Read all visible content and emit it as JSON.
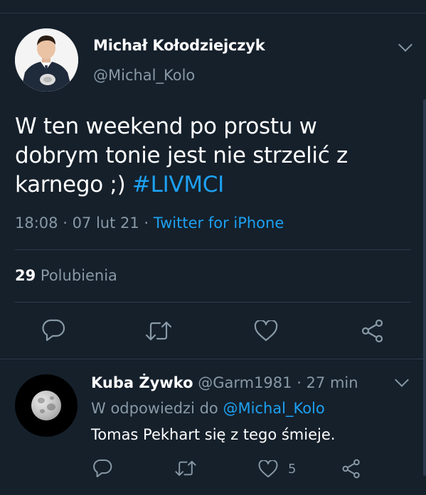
{
  "tweet": {
    "author_name": "Michał Kołodziejczyk",
    "author_handle": "@Michal_Kolo",
    "text": "W ten weekend po prostu w dobrym tonie jest nie strzelić z karnego ;) ",
    "hashtag": "#LIVMCI",
    "time": "18:08",
    "date": "07 lut 21",
    "source": "Twitter for iPhone",
    "likes_count": "29",
    "likes_label": "Polubienia"
  },
  "reply": {
    "author_name": "Kuba Żywko",
    "author_handle": "@Garm1981",
    "time_ago": "27 min",
    "reply_to_prefix": "W odpowiedzi do",
    "reply_to_handle": "@Michal_Kolo",
    "text": "Tomas Pekhart się z tego śmieje.",
    "like_count": "5"
  },
  "colors": {
    "background": "#15202b",
    "accent": "#1da1f2",
    "secondary_text": "#8899a6"
  },
  "icons": [
    "chevron-down-icon",
    "reply-icon",
    "retweet-icon",
    "like-icon",
    "share-icon"
  ]
}
